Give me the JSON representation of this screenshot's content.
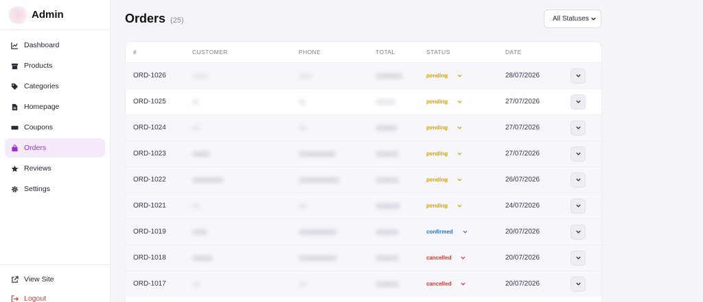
{
  "sidebar": {
    "brand": "Admin",
    "items": [
      {
        "label": "Dashboard",
        "icon": "chart-icon"
      },
      {
        "label": "Products",
        "icon": "box-icon"
      },
      {
        "label": "Categories",
        "icon": "tag-icon"
      },
      {
        "label": "Homepage",
        "icon": "document-icon"
      },
      {
        "label": "Coupons",
        "icon": "ticket-icon"
      },
      {
        "label": "Orders",
        "icon": "bag-icon",
        "active": true
      },
      {
        "label": "Reviews",
        "icon": "star-icon"
      },
      {
        "label": "Settings",
        "icon": "gear-icon"
      }
    ],
    "bottom": [
      {
        "label": "View Site",
        "icon": "external-link-icon"
      },
      {
        "label": "Logout",
        "icon": "logout-icon"
      }
    ]
  },
  "header": {
    "title": "Orders",
    "count": "(25)",
    "filter_value": "All Statuses"
  },
  "table": {
    "columns": [
      "#",
      "CUSTOMER",
      "PHONE",
      "TOTAL",
      "STATUS",
      "DATE"
    ],
    "rows": [
      {
        "id": "ORD-1026",
        "status": "pending",
        "date": "28/07/2026"
      },
      {
        "id": "ORD-1025",
        "status": "pending",
        "date": "27/07/2026"
      },
      {
        "id": "ORD-1024",
        "status": "pending",
        "date": "27/07/2026"
      },
      {
        "id": "ORD-1023",
        "status": "pending",
        "date": "27/07/2026"
      },
      {
        "id": "ORD-1022",
        "status": "pending",
        "date": "26/07/2026"
      },
      {
        "id": "ORD-1021",
        "status": "pending",
        "date": "24/07/2026"
      },
      {
        "id": "ORD-1019",
        "status": "confirmed",
        "date": "20/07/2026"
      },
      {
        "id": "ORD-1018",
        "status": "cancelled",
        "date": "20/07/2026"
      },
      {
        "id": "ORD-1017",
        "status": "cancelled",
        "date": "20/07/2026"
      }
    ]
  },
  "colors": {
    "accent": "#9b2fd6",
    "pending": "#d6a100",
    "confirmed": "#2a6fd6",
    "cancelled": "#d8332a"
  }
}
